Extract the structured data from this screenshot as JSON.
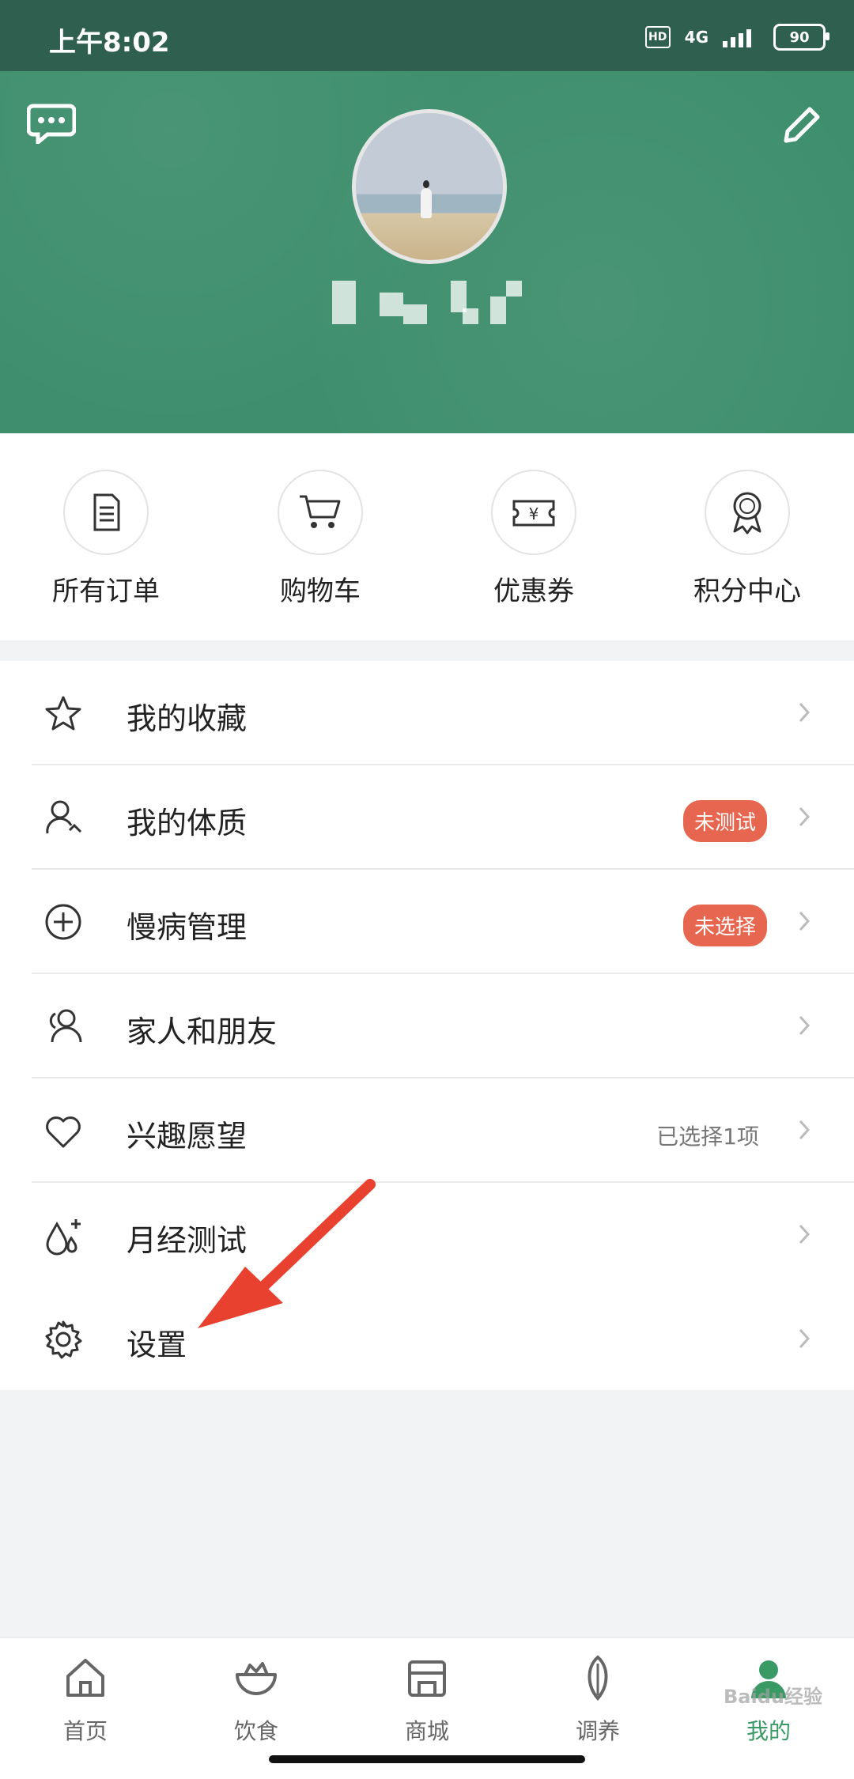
{
  "status_bar": {
    "time": "上午8:02",
    "hd": "HD",
    "network": "4G",
    "battery": "90"
  },
  "profile": {
    "message_icon": "chat-bubble-icon",
    "edit_icon": "pencil-icon"
  },
  "quick_actions": [
    {
      "label": "所有订单",
      "icon": "document-icon"
    },
    {
      "label": "购物车",
      "icon": "cart-icon"
    },
    {
      "label": "优惠券",
      "icon": "coupon-icon"
    },
    {
      "label": "积分中心",
      "icon": "medal-icon"
    }
  ],
  "menu": [
    {
      "label": "我的收藏",
      "icon": "star-icon"
    },
    {
      "label": "我的体质",
      "icon": "person-check-icon",
      "badge": "未测试"
    },
    {
      "label": "慢病管理",
      "icon": "plus-circle-icon",
      "badge": "未选择"
    },
    {
      "label": "家人和朋友",
      "icon": "friends-icon"
    },
    {
      "label": "兴趣愿望",
      "icon": "heart-icon",
      "meta": "已选择1项"
    },
    {
      "label": "月经测试",
      "icon": "drop-plus-icon"
    },
    {
      "label": "设置",
      "icon": "gear-icon"
    }
  ],
  "tabs": [
    {
      "label": "首页",
      "icon": "home-icon"
    },
    {
      "label": "饮食",
      "icon": "bowl-icon"
    },
    {
      "label": "商城",
      "icon": "store-icon"
    },
    {
      "label": "调养",
      "icon": "leaf-icon"
    },
    {
      "label": "我的",
      "icon": "user-icon",
      "active": true
    }
  ],
  "colors": {
    "header": "#3f8f6e",
    "accent": "#3a9a66",
    "badge": "#e7664f"
  },
  "watermark": "Baidu经验"
}
